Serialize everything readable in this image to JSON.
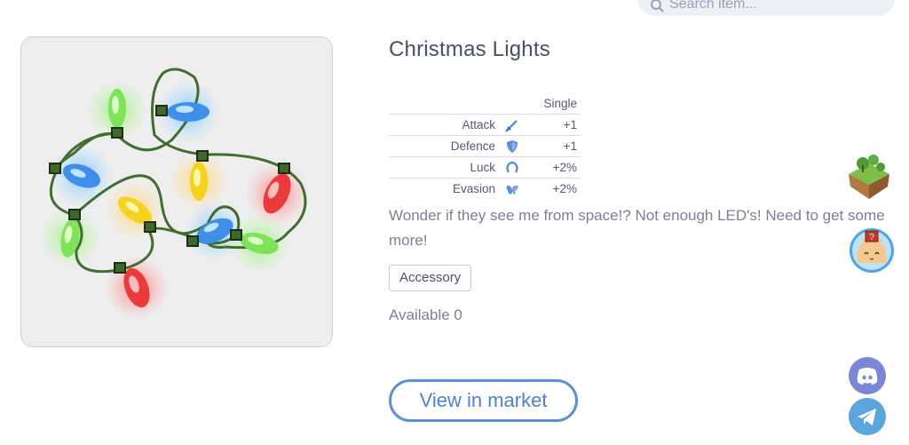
{
  "search": {
    "placeholder": "Search item..."
  },
  "item": {
    "title": "Christmas Lights",
    "stats_header": "Single",
    "stats": [
      {
        "name": "Attack",
        "icon": "sword-icon",
        "value": "+1"
      },
      {
        "name": "Defence",
        "icon": "shield-icon",
        "value": "+1"
      },
      {
        "name": "Luck",
        "icon": "horseshoe-icon",
        "value": "+2%"
      },
      {
        "name": "Evasion",
        "icon": "wings-icon",
        "value": "+2%"
      }
    ],
    "description": "Wonder if they see me from space!? Not enough LED's! Need to get some more!",
    "tag": "Accessory",
    "available": "Available 0",
    "market_button": "View in market"
  },
  "colors": {
    "accent": "#5b8fd6",
    "discord": "#7b86d6",
    "telegram": "#5aa5dc"
  }
}
